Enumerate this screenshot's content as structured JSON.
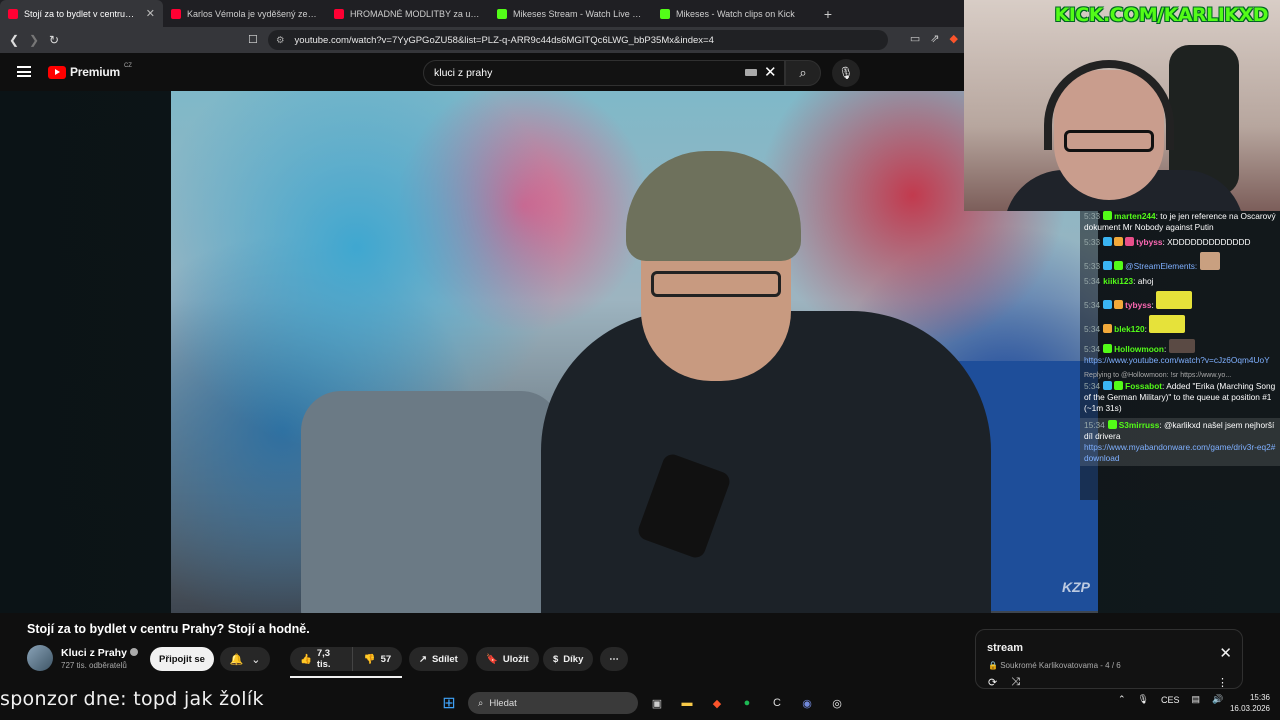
{
  "browser": {
    "tabs": [
      {
        "title": "Stojí za to bydlet v centru Pra",
        "favicon": "youtube-icon",
        "color": "#ff0033",
        "active": true
      },
      {
        "title": "Karlos Vémola je vyděšený ze svého",
        "favicon": "youtube-icon",
        "color": "#ff0033"
      },
      {
        "title": "HROMADNÉ MODLITBY za uzdraven",
        "favicon": "youtube-icon",
        "color": "#ff0033"
      },
      {
        "title": "Mikeses Stream - Watch Live on Kick",
        "favicon": "kick-icon",
        "color": "#53fc18"
      },
      {
        "title": "Mikeses - Watch clips on Kick",
        "favicon": "kick-icon",
        "color": "#53fc18"
      }
    ],
    "new_tab": "+",
    "tab_close": "✕",
    "url": "youtube.com/watch?v=7YyGPGoZU58&list=PLZ-q-ARR9c44ds6MGITQc6LWG_bbP35Mx&index=4"
  },
  "youtube": {
    "brand": "Premium",
    "region": "CZ",
    "search_value": "kluci z prahy"
  },
  "video": {
    "watermark": "KZP",
    "title": "Stojí za to bydlet v centru Prahy? Stojí a hodně.",
    "channel": "Kluci z Prahy",
    "subscribers": "727 tis. odběratelů",
    "join_label": "Připojit se",
    "likes": "7,3 tis.",
    "dislikes": "57",
    "share_label": "Sdílet",
    "save_label": "Uložit",
    "thanks_label": "Díky"
  },
  "playlist": {
    "title": "stream",
    "visibility": "Soukromé",
    "owner": "Karlikovatovama",
    "position": "4 / 6"
  },
  "overlay": {
    "kick_url": "KICK.COM/KARLIKXD",
    "sponsor": "sponzor dne: topd jak žolík"
  },
  "chat": [
    {
      "ts": "5:33",
      "user": "marten244",
      "user_color": "#53fc18",
      "text": "to je jen reference na Oscarový dokument Mr Nobody against Putin"
    },
    {
      "ts": "5:33",
      "user": "tybyss",
      "user_color": "#ff69b4",
      "text": "XDDDDDDDDDDDDD"
    },
    {
      "ts": "5:33",
      "user": "",
      "user_color": "#7fb0ff",
      "text": "@StreamElements:"
    },
    {
      "ts": "5:34",
      "user": "kiiki123",
      "user_color": "#53fc18",
      "text": "ahoj"
    },
    {
      "ts": "5:34",
      "user": "tybyss",
      "user_color": "#ff69b4",
      "text": ""
    },
    {
      "ts": "5:34",
      "user": "blek120",
      "user_color": "#53fc18",
      "text": ""
    },
    {
      "ts": "5:34",
      "user": "Hollowmoon",
      "user_color": "#53fc18",
      "text": "",
      "link": "https://www.youtube.com/watch?v=cJz6Oqm4UoY"
    },
    {
      "reply": "Replying to @Hollowmoon: !sr https://www.yo...",
      "ts": "5:34",
      "user": "Fossabot",
      "user_color": "#53fc18",
      "text": "Added \"Erika (Marching Song of the German Military)\" to the queue at position #1 (~1m 31s)"
    },
    {
      "ts": "15:34",
      "user": "S3mirruss",
      "user_color": "#53fc18",
      "text": "@karlikxd našel jsem nejhorší díl drivera",
      "link": "https://www.myabandonware.com/game/driv3r-eq2#download"
    }
  ],
  "taskbar": {
    "search_placeholder": "Hledat",
    "lang": "CES",
    "time": "15:36",
    "date": "16.03.2026"
  }
}
